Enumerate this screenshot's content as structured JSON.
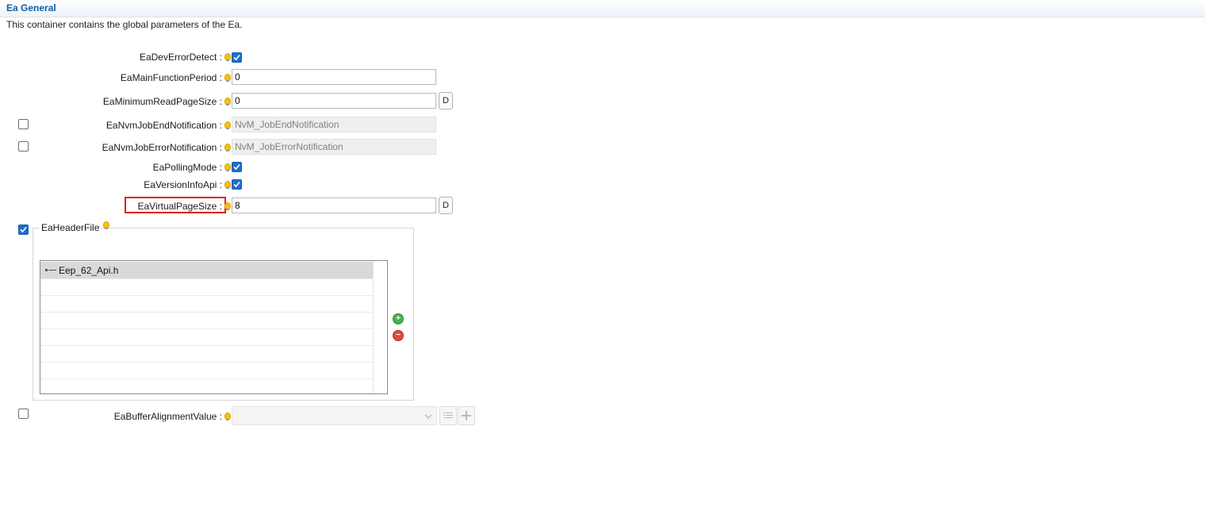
{
  "header": {
    "title": "Ea General",
    "description": "This container contains the global parameters of the Ea."
  },
  "params": {
    "dev_error_detect": {
      "label": "EaDevErrorDetect :",
      "checked": true
    },
    "main_function_period": {
      "label": "EaMainFunctionPeriod :",
      "value": "0"
    },
    "minimum_read_page_size": {
      "label": "EaMinimumReadPageSize :",
      "value": "0",
      "default_button": "D"
    },
    "nvm_job_end_notification": {
      "label": "EaNvmJobEndNotification :",
      "value": "NvM_JobEndNotification",
      "enabled": false
    },
    "nvm_job_error_notification": {
      "label": "EaNvmJobErrorNotification :",
      "value": "NvM_JobErrorNotification",
      "enabled": false
    },
    "polling_mode": {
      "label": "EaPollingMode :",
      "checked": true
    },
    "version_info_api": {
      "label": "EaVersionInfoApi :",
      "checked": true
    },
    "virtual_page_size": {
      "label": "EaVirtualPageSize :",
      "value": "8",
      "default_button": "D"
    },
    "buffer_alignment_value": {
      "label": "EaBufferAlignmentValue :",
      "value": "",
      "enabled": false
    }
  },
  "header_file": {
    "title": "EaHeaderFile",
    "enabled": true,
    "items": [
      "Eep_62_Api.h"
    ],
    "add_icon": "add-circle-icon",
    "remove_icon": "remove-circle-icon"
  },
  "colors": {
    "accent": "#0b5fa8",
    "checkbox": "#1d6fd1",
    "highlight": "#e02020",
    "add": "#4caf50",
    "remove": "#e04848"
  }
}
